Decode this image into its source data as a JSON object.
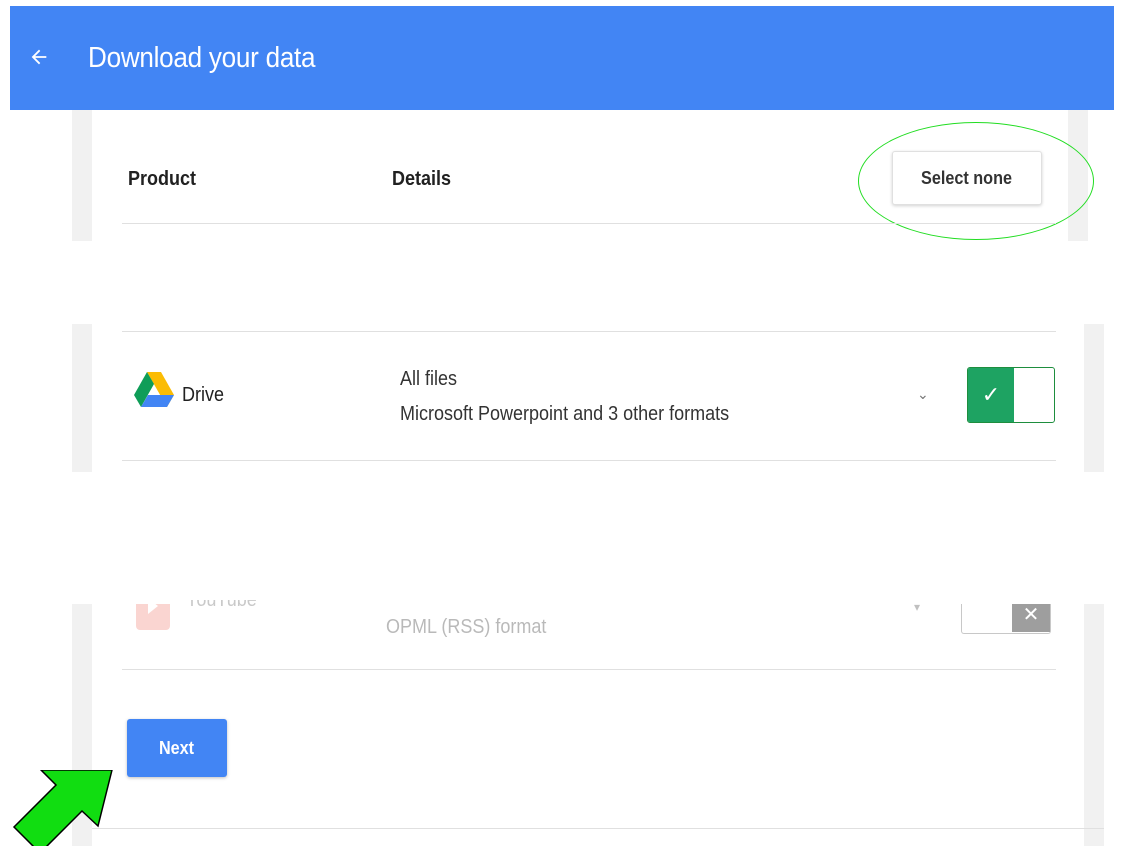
{
  "header": {
    "title": "Download your data",
    "background": "#4285f4"
  },
  "table": {
    "columns": [
      "Product",
      "Details"
    ],
    "select_none_label": "Select none"
  },
  "rows": [
    {
      "product": "Drive",
      "icon": "google-drive-icon",
      "details": [
        "All files",
        "Microsoft Powerpoint and 3 other formats"
      ],
      "toggle": {
        "state": "on",
        "glyph": "✓",
        "color": "#1ea362"
      }
    },
    {
      "product": "YouTube",
      "icon": "youtube-icon",
      "details": [
        "OPML (RSS) format"
      ],
      "toggle": {
        "state": "off",
        "glyph": "✕",
        "color": "#9e9e9e"
      }
    }
  ],
  "footer": {
    "next_label": "Next"
  },
  "annotations": {
    "highlight_color": "#22dd22",
    "arrow_color": "#11dd11"
  }
}
